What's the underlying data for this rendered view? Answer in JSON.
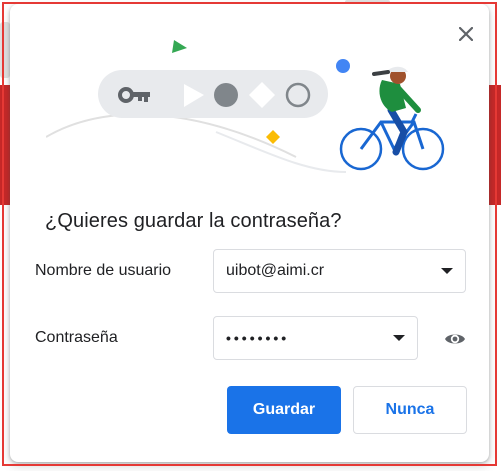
{
  "dialog": {
    "title": "¿Quieres guardar la contraseña?",
    "close_icon": "close-icon",
    "illustration_icon": "password-key-illustration"
  },
  "form": {
    "username_label": "Nombre de usuario",
    "username_value": "uibot@aimi.cr",
    "password_label": "Contraseña",
    "password_value": "••••••••",
    "reveal_icon": "eye-icon",
    "dropdown_icon": "chevron-down-icon"
  },
  "actions": {
    "save_label": "Guardar",
    "cancel_label": "Nunca"
  },
  "colors": {
    "accent": "#1a73e8",
    "frame": "#e53935",
    "background_strip": "#c62828"
  }
}
